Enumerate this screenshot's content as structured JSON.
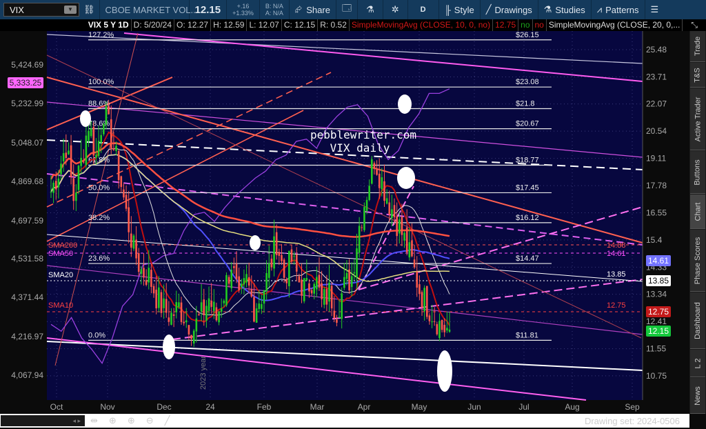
{
  "toolbar": {
    "symbol": "VIX",
    "description": "CBOE MARKET VOL...",
    "last": "12.15",
    "change": "+.16",
    "change_pct": "+1.33%",
    "bid": "B: N/A",
    "ask": "A: N/A",
    "share": "Share",
    "period": "D",
    "style": "Style",
    "drawings": "Drawings",
    "studies": "Studies",
    "patterns": "Patterns"
  },
  "infobar": {
    "title": "VIX 5 Y 1D",
    "date": "D: 5/20/24",
    "open": "O: 12.27",
    "high": "H: 12.59",
    "low": "L: 12.07",
    "close": "C: 12.15",
    "range": "R: 0.52",
    "sma10": "SimpleMovingAvg (CLOSE, 10, 0, no)",
    "sma10_val": "12.75",
    "no1": "no",
    "no2": "no",
    "sma20": "SimpleMovingAvg (CLOSE, 20, 0,..."
  },
  "chart": {
    "watermark1": "pebblewriter.com",
    "watermark2": "VIX daily",
    "year_label": "2023 year",
    "sma_labels": [
      "SMA200",
      "SMA50",
      "SMA20",
      "SMA10"
    ],
    "level_labels": [
      {
        "text": "14.88",
        "color": "#ff5555"
      },
      {
        "text": "14.61",
        "color": "#ff55ff"
      },
      {
        "text": "13.85",
        "color": "#ffffff"
      },
      {
        "text": "12.75",
        "color": "#ff4444"
      }
    ],
    "badges": [
      {
        "text": "14.61",
        "bg": "#7373ff",
        "fg": "#fff"
      },
      {
        "text": "13.85",
        "bg": "#ffffff",
        "fg": "#000"
      },
      {
        "text": "12.75",
        "bg": "#c41a1a",
        "fg": "#fff"
      },
      {
        "text": "12.15",
        "bg": "#14c83c",
        "fg": "#fff"
      }
    ],
    "left_badge": {
      "text": "5,333.25",
      "bg": "#ff66ff"
    }
  },
  "chart_data": {
    "type": "candlestick",
    "title": "VIX 5 Y 1D",
    "right_axis": [
      "25.48",
      "23.71",
      "22.07",
      "20.54",
      "19.11",
      "17.78",
      "16.55",
      "15.4",
      "14.33",
      "13.34",
      "12.41",
      "11.55",
      "10.75"
    ],
    "right_axis_values": [
      25.48,
      23.71,
      22.07,
      20.54,
      19.11,
      17.78,
      16.55,
      15.4,
      14.33,
      13.34,
      12.41,
      11.55,
      10.75
    ],
    "left_axis": [
      "5,424.69",
      "5,232.99",
      "5,048.07",
      "4,869.68",
      "4,697.59",
      "4,531.58",
      "4,371.44",
      "4,216.97",
      "4,067.94"
    ],
    "x_ticks": [
      "Oct",
      "Nov",
      "Dec",
      "24",
      "Feb",
      "Mar",
      "Apr",
      "May",
      "Jun",
      "Jul",
      "Aug",
      "Sep"
    ],
    "fib_levels": [
      {
        "pct": "127.2%",
        "value": "$26.15",
        "v": 26.15
      },
      {
        "pct": "100.0%",
        "value": "$23.08",
        "v": 23.08
      },
      {
        "pct": "88.6%",
        "value": "$21.8",
        "v": 21.8
      },
      {
        "pct": "78.6%",
        "value": "$20.67",
        "v": 20.67
      },
      {
        "pct": "61.8%",
        "value": "$18.77",
        "v": 18.77
      },
      {
        "pct": "50.0%",
        "value": "$17.45",
        "v": 17.45
      },
      {
        "pct": "38.2%",
        "value": "$16.12",
        "v": 16.12
      },
      {
        "pct": "23.6%",
        "value": "$14.47",
        "v": 14.47
      },
      {
        "pct": "0.0%",
        "value": "$11.81",
        "v": 11.81
      }
    ],
    "vix_close_anchors": [
      17.5,
      18.5,
      19.8,
      17.2,
      18.9,
      21.0,
      19.2,
      21.7,
      20.2,
      18.5,
      16.5,
      15.0,
      14.2,
      14.0,
      13.3,
      12.8,
      12.6,
      12.9,
      12.5,
      12.2,
      12.6,
      13.2,
      12.5,
      13.4,
      14.5,
      13.0,
      13.8,
      12.9,
      13.3,
      14.2,
      15.4,
      14.0,
      14.6,
      13.8,
      13.5,
      14.1,
      13.0,
      13.4,
      12.8,
      13.6,
      14.0,
      16.0,
      17.5,
      19.2,
      18.0,
      17.0,
      16.2,
      15.4,
      14.5,
      13.5,
      13.0,
      12.6,
      12.2,
      12.15
    ],
    "spx_anchors": [
      4290,
      4260,
      4320,
      4230,
      4180,
      4120,
      4230,
      4370,
      4420,
      4550,
      4560,
      4590,
      4600,
      4700,
      4770,
      4780,
      4740,
      4800,
      4850,
      4890,
      4930,
      4960,
      5010,
      5030,
      5090,
      5100,
      5060,
      5150,
      5200,
      5240,
      5250,
      5200,
      5080,
      5010,
      5050,
      5150,
      5210,
      5300,
      5300,
      5320
    ]
  },
  "tabs": [
    "Trade",
    "T&S",
    "Active Trader",
    "Buttons",
    "Chart",
    "Phase Scores",
    "Dashboard",
    "L 2",
    "News"
  ],
  "bottom": {
    "drawing_set": "Drawing set: 2024-0506"
  }
}
